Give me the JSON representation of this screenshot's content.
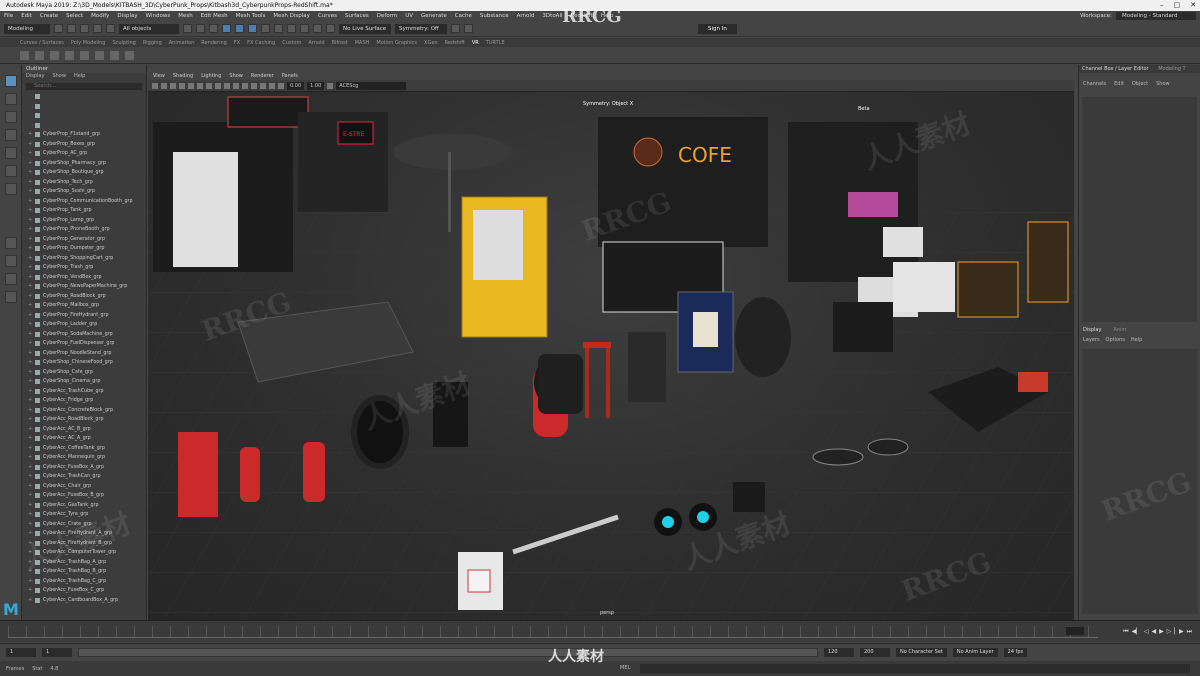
{
  "window": {
    "title": "Autodesk Maya 2019: Z:\\3D_Models\\KITBASH_3D\\CyberPunk_Props\\Kitbash3d_CyberpunkProps-RedShift.ma*"
  },
  "menubar": {
    "items": [
      "File",
      "Edit",
      "Create",
      "Select",
      "Modify",
      "Display",
      "Windows",
      "Mesh",
      "Edit Mesh",
      "Mesh Tools",
      "Mesh Display",
      "Curves",
      "Surfaces",
      "Deform",
      "UV",
      "Generate",
      "Cache",
      "Substance",
      "Arnold",
      "3DtoAll",
      "Redshift",
      "Help"
    ],
    "workspace_label": "Workspace:",
    "workspace_value": "Modeling - Standard"
  },
  "statusline": {
    "mode": "Modeling",
    "objects": "All objects",
    "live_surface": "No Live Surface",
    "symmetry": "Symmetry: Off",
    "sign_in": "Sign In"
  },
  "shelf": {
    "tabs": [
      "Curves / Surfaces",
      "Poly Modeling",
      "Sculpting",
      "Rigging",
      "Animation",
      "Rendering",
      "FX",
      "FX Caching",
      "Custom",
      "Arnold",
      "Bifrost",
      "MASH",
      "Motion Graphics",
      "XGen",
      "Redshift",
      "VR",
      "TURTLE"
    ],
    "active_tab": "VR"
  },
  "outliner": {
    "title": "Outliner",
    "menu": [
      "Display",
      "Show",
      "Help"
    ],
    "search_placeholder": "Search...",
    "items": [
      "",
      "",
      "",
      "",
      "CyberProp_F1stand_grp",
      "CyberProp_Boxes_grp",
      "CyberProp_AC_grp",
      "CyberShop_Pharmacy_grp",
      "CyberShop_Boutique_grp",
      "CyberShop_Tech_grp",
      "CyberShop_Sushi_grp",
      "CyberProp_CommunicationBooth_grp",
      "CyberProp_Tank_grp",
      "CyberProp_Lamp_grp",
      "CyberProp_PhoneBooth_grp",
      "CyberProp_Generator_grp",
      "CyberProp_Dumpster_grp",
      "CyberProp_ShoppingCart_grp",
      "CyberProp_Trash_grp",
      "CyberProp_VendBox_grp",
      "CyberProp_NewsPaperMachine_grp",
      "CyberProp_RoadBlock_grp",
      "CyberProp_Mailbox_grp",
      "CyberProp_FireHydrant_grp",
      "CyberProp_Ladder_grp",
      "CyberProp_SodaMachine_grp",
      "CyberProp_FuelDispenser_grp",
      "CyberProp_NoodleStand_grp",
      "CyberShop_ChineseFood_grp",
      "CyberShop_Cafe_grp",
      "CyberShop_Cinema_grp",
      "CyberAcc_TrashCube_grp",
      "CyberAcc_Fridge_grp",
      "CyberAcc_ConcreteBlock_grp",
      "CyberAcc_RoadBlock_grp",
      "CyberAcc_AC_B_grp",
      "CyberAcc_AC_A_grp",
      "CyberAcc_CoffeeTank_grp",
      "CyberAcc_Mannequin_grp",
      "CyberAcc_FuseBox_A_grp",
      "CyberAcc_TrashCan_grp",
      "CyberAcc_Chair_grp",
      "CyberAcc_FuseBox_B_grp",
      "CyberAcc_GasTank_grp",
      "CyberAcc_Tyre_grp",
      "CyberAcc_Crate_grp",
      "CyberAcc_FireHydrant_A_grp",
      "CyberAcc_FireHydrant_B_grp",
      "CyberAcc_ComputerTower_grp",
      "CyberAcc_TrashBag_A_grp",
      "CyberAcc_TrashBag_B_grp",
      "CyberAcc_TrashBag_C_grp",
      "CyberAcc_FuseBox_C_grp",
      "CyberAcc_CardboardBox_A_grp"
    ]
  },
  "viewport": {
    "menu": [
      "View",
      "Shading",
      "Lighting",
      "Show",
      "Renderer",
      "Panels"
    ],
    "near_value": "0.00",
    "far_value": "1.00",
    "color_space": "ACEScg",
    "symmetry_label": "Symmetry: Object X",
    "camera_label": "persp",
    "neon_signs": [
      "COFE",
      "E-STRE",
      "Beta"
    ]
  },
  "channelbox": {
    "title": "Channel Box / Layer Editor",
    "workspace_tab": "Modeling T",
    "menu": [
      "Channels",
      "Edit",
      "Object",
      "Show"
    ]
  },
  "layers": {
    "tabs": [
      "Display",
      "Anim"
    ],
    "menu": [
      "Layers",
      "Options",
      "Help"
    ]
  },
  "timeslider": {
    "playback_icons": [
      "skip-start",
      "step-back",
      "prev-key",
      "play-back",
      "play",
      "next-key",
      "step-forward",
      "skip-end"
    ]
  },
  "rangeslider": {
    "start": "1",
    "start_inner": "1",
    "end_inner": "120",
    "end": "120",
    "end_max": "200",
    "character_set": "No Character Set",
    "anim_layer": "No Anim Layer",
    "fps": "24 fps"
  },
  "cmdline": {
    "left_label_a": "Frames",
    "left_label_b": "Stat",
    "left_value": "4.8",
    "mel_label": "MEL"
  },
  "watermarks": {
    "top": "RRCG",
    "bottom": "人人素材",
    "tiles": [
      "RRCG",
      "人人素材",
      "RRCG",
      "人人素材",
      "RRCG",
      "人人素材",
      "RRCG",
      "人人素材"
    ]
  },
  "colors": {
    "accent": "#5d8fbf",
    "maya_logo": "#36a8d8",
    "neon_orange": "#f0a030",
    "vending_yellow": "#e8b820",
    "prop_red": "#cc2a2a",
    "cyan_light": "#1fd0e8"
  }
}
